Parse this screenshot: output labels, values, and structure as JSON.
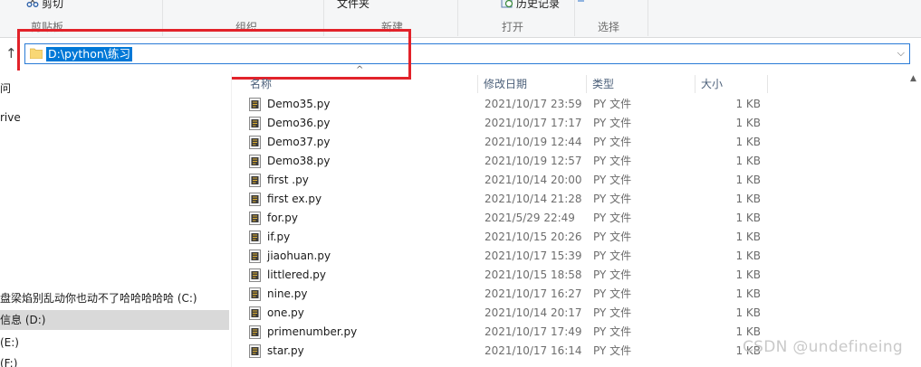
{
  "ribbon": {
    "cut_label": "剪切",
    "clipboard_group": "剪贴板",
    "organize_group": "组织",
    "new_folder_label": "文件夹",
    "new_group": "新建",
    "history_label": "历史记录",
    "open_group": "打开",
    "select_group": "选择"
  },
  "address": {
    "path": "D:\\python\\练习"
  },
  "nav": {
    "items": [
      {
        "label": "问",
        "selected": false
      },
      {
        "label": "rive",
        "selected": false
      },
      {
        "label": "盘梁焰别乱动你也动不了哈哈哈哈哈 (C:)",
        "selected": false
      },
      {
        "label": "信息 (D:)",
        "selected": true
      },
      {
        "label": "(E:)",
        "selected": false
      },
      {
        "label": "(F:)",
        "selected": false
      }
    ]
  },
  "columns": {
    "name": "名称",
    "date": "修改日期",
    "type": "类型",
    "size": "大小"
  },
  "files": [
    {
      "name": "Demo35.py",
      "date": "2021/10/17 23:59",
      "type": "PY 文件",
      "size": "1 KB"
    },
    {
      "name": "Demo36.py",
      "date": "2021/10/17 17:17",
      "type": "PY 文件",
      "size": "1 KB"
    },
    {
      "name": "Demo37.py",
      "date": "2021/10/19 12:44",
      "type": "PY 文件",
      "size": "1 KB"
    },
    {
      "name": "Demo38.py",
      "date": "2021/10/19 12:57",
      "type": "PY 文件",
      "size": "1 KB"
    },
    {
      "name": "first .py",
      "date": "2021/10/14 20:00",
      "type": "PY 文件",
      "size": "1 KB"
    },
    {
      "name": "first ex.py",
      "date": "2021/10/14 21:28",
      "type": "PY 文件",
      "size": "1 KB"
    },
    {
      "name": "for.py",
      "date": "2021/5/29 22:49",
      "type": "PY 文件",
      "size": "1 KB"
    },
    {
      "name": "if.py",
      "date": "2021/10/15 20:26",
      "type": "PY 文件",
      "size": "1 KB"
    },
    {
      "name": "jiaohuan.py",
      "date": "2021/10/17 15:39",
      "type": "PY 文件",
      "size": "1 KB"
    },
    {
      "name": "littlered.py",
      "date": "2021/10/15 18:58",
      "type": "PY 文件",
      "size": "1 KB"
    },
    {
      "name": "nine.py",
      "date": "2021/10/17 16:27",
      "type": "PY 文件",
      "size": "1 KB"
    },
    {
      "name": "one.py",
      "date": "2021/10/14 20:17",
      "type": "PY 文件",
      "size": "1 KB"
    },
    {
      "name": "primenumber.py",
      "date": "2021/10/17 17:49",
      "type": "PY 文件",
      "size": "1 KB"
    },
    {
      "name": "star.py",
      "date": "2021/10/17 16:14",
      "type": "PY 文件",
      "size": "1 KB"
    }
  ],
  "watermark": "CSDN @undefineing",
  "colors": {
    "selection": "#0078d7",
    "highlight_box": "#e2222a",
    "nav_selected": "#d9d9d9"
  }
}
